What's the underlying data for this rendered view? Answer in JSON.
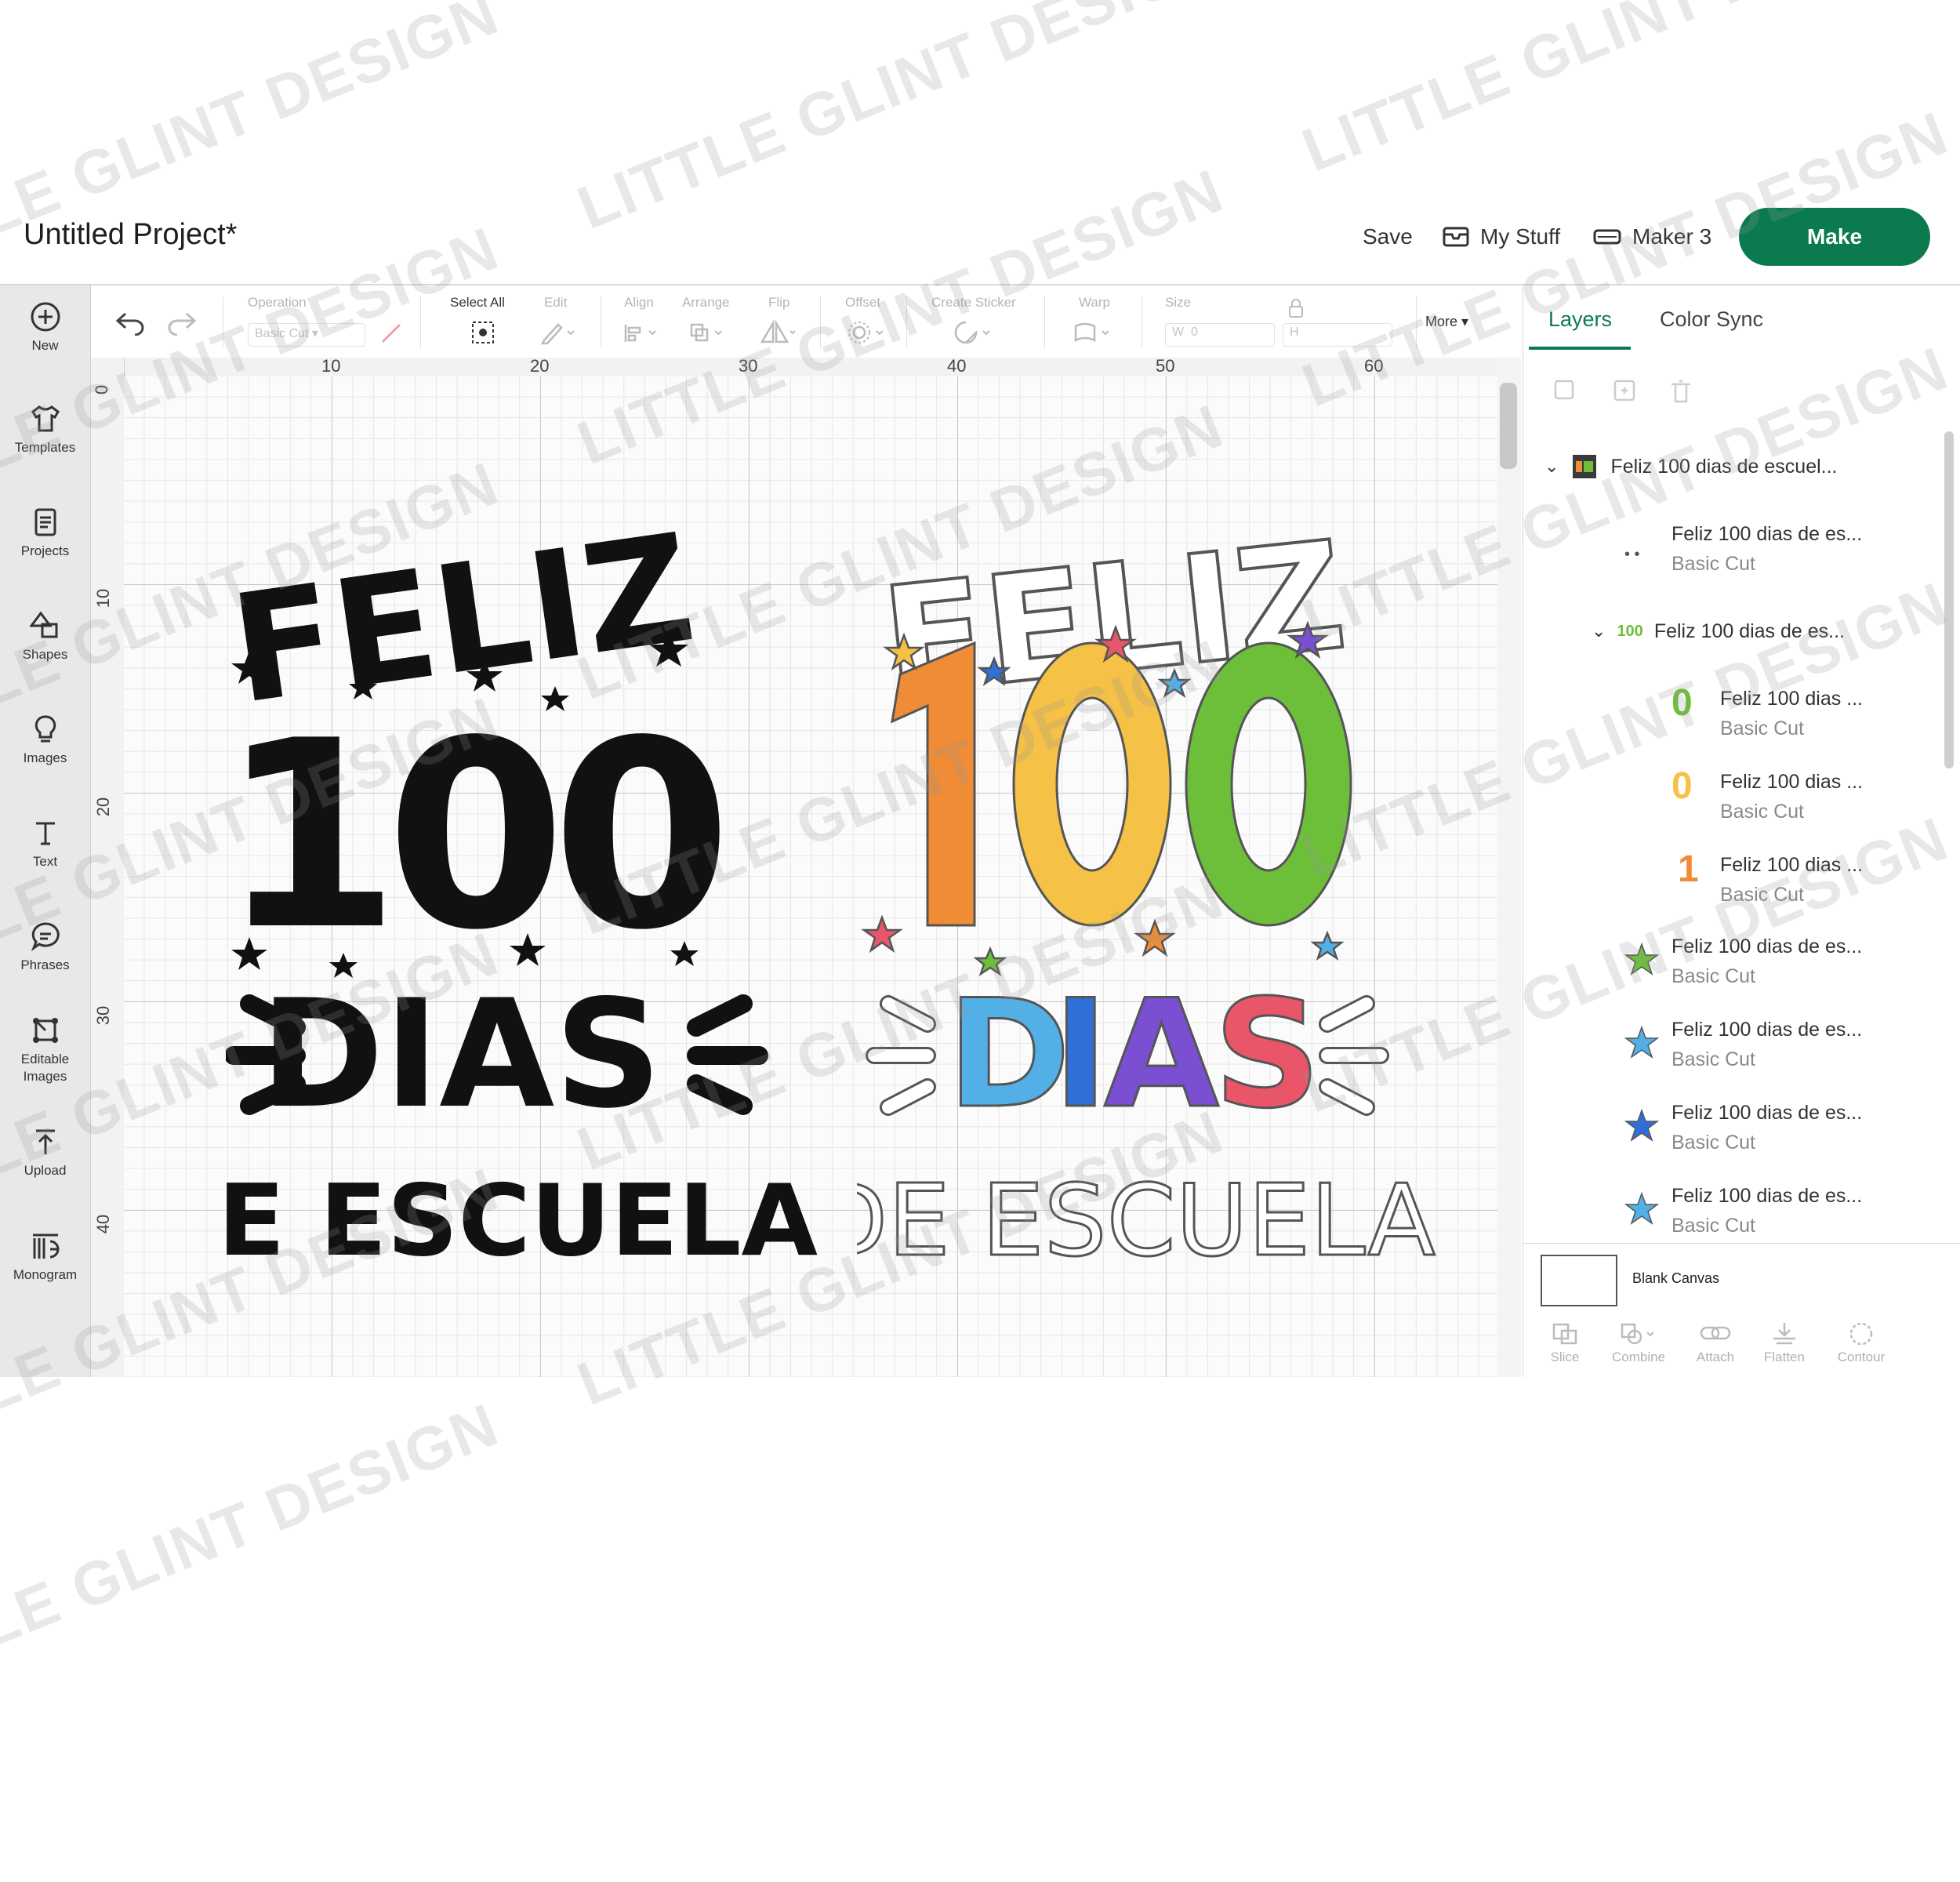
{
  "header": {
    "title": "Untitled Project*",
    "save_label": "Save",
    "mystuff_label": "My Stuff",
    "machine_label": "Maker 3",
    "make_label": "Make"
  },
  "sidebar": {
    "items": [
      {
        "label": "New",
        "icon": "plus-circle-icon"
      },
      {
        "label": "Templates",
        "icon": "shirt-icon"
      },
      {
        "label": "Projects",
        "icon": "projects-icon"
      },
      {
        "label": "Shapes",
        "icon": "shapes-icon"
      },
      {
        "label": "Images",
        "icon": "lightbulb-icon"
      },
      {
        "label": "Text",
        "icon": "text-icon"
      },
      {
        "label": "Phrases",
        "icon": "speech-bubble-icon"
      },
      {
        "label": "Editable",
        "label2": "Images",
        "icon": "editable-images-icon"
      },
      {
        "label": "Upload",
        "icon": "upload-icon"
      },
      {
        "label": "Monogram",
        "icon": "monogram-icon"
      }
    ]
  },
  "toolbar": {
    "operation_label": "Operation",
    "operation_value": "Basic Cut",
    "select_all_label": "Select All",
    "edit_label": "Edit",
    "align_label": "Align",
    "arrange_label": "Arrange",
    "flip_label": "Flip",
    "offset_label": "Offset",
    "create_sticker_label": "Create Sticker",
    "warp_label": "Warp",
    "size_label": "Size",
    "w_label": "W",
    "w_value": "0",
    "h_label": "H",
    "more_label": "More"
  },
  "ruler": {
    "top": [
      "10",
      "20",
      "30",
      "40",
      "50",
      "60"
    ],
    "left": [
      "0",
      "10",
      "20",
      "30",
      "40"
    ]
  },
  "designs": {
    "left": {
      "line1": "FELIZ",
      "line2": "100",
      "line3": "DIAS",
      "line4": "DE ESCUELA",
      "color": "#111111"
    },
    "right": {
      "line1": "FELIZ",
      "line2": "100",
      "line3": "DIAS",
      "line4": "DE ESCUELA",
      "colors": {
        "one": "#ef8c35",
        "zero1": "#f5c146",
        "zero2": "#6dbf3a",
        "D": "#52b0e6",
        "I": "#2f6fd6",
        "A": "#7a4fd1",
        "S": "#e9566a"
      }
    }
  },
  "panel": {
    "tab_layers": "Layers",
    "tab_colorsync": "Color Sync",
    "group_name": "Feliz 100 dias de escuel...",
    "layers": [
      {
        "name": "Feliz 100 dias de es...",
        "sub": "Basic Cut"
      },
      {
        "name": "Feliz 100 dias de es...",
        "sub": ""
      },
      {
        "name": "Feliz 100 dias ...",
        "sub": "Basic Cut"
      },
      {
        "name": "Feliz 100 dias ...",
        "sub": "Basic Cut"
      },
      {
        "name": "Feliz 100 dias ...",
        "sub": "Basic Cut"
      },
      {
        "name": "Feliz 100 dias de es...",
        "sub": "Basic Cut"
      },
      {
        "name": "Feliz 100 dias de es...",
        "sub": "Basic Cut"
      },
      {
        "name": "Feliz 100 dias de es...",
        "sub": "Basic Cut"
      },
      {
        "name": "Feliz 100 dias de es...",
        "sub": "Basic Cut"
      }
    ],
    "blank_canvas": "Blank Canvas",
    "bottom_tools": [
      "Slice",
      "Combine",
      "Attach",
      "Flatten",
      "Contour"
    ]
  },
  "watermark": "LITTLE GLINT DESIGN",
  "colors": {
    "accent": "#0b7b4f"
  }
}
